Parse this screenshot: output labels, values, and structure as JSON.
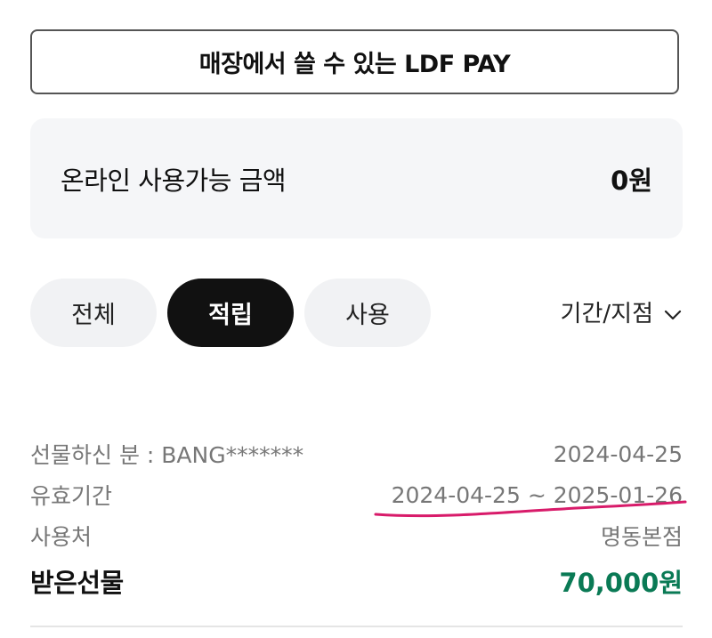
{
  "store_pay_button": {
    "label": "매장에서 쓸 수 있는 LDF PAY"
  },
  "balance": {
    "label": "온라인 사용가능 금액",
    "value": "0원"
  },
  "tabs": [
    {
      "label": "전체",
      "active": false
    },
    {
      "label": "적립",
      "active": true
    },
    {
      "label": "사용",
      "active": false
    }
  ],
  "period_filter": {
    "label": "기간/지점",
    "icon": "chevron-down-icon"
  },
  "record": {
    "sender_label": "선물하신 분 : BANG*******",
    "date": "2024-04-25",
    "validity_label": "유효기간",
    "validity_value": "2024-04-25 ~ 2025-01-26",
    "store_label": "사용처",
    "store_value": "명동본점",
    "gift_label": "받은선물",
    "gift_amount": "70,000원"
  },
  "colors": {
    "accent_green": "#0a7a55",
    "annotation_pink": "#d81b6a",
    "active_tab": "#111111"
  }
}
